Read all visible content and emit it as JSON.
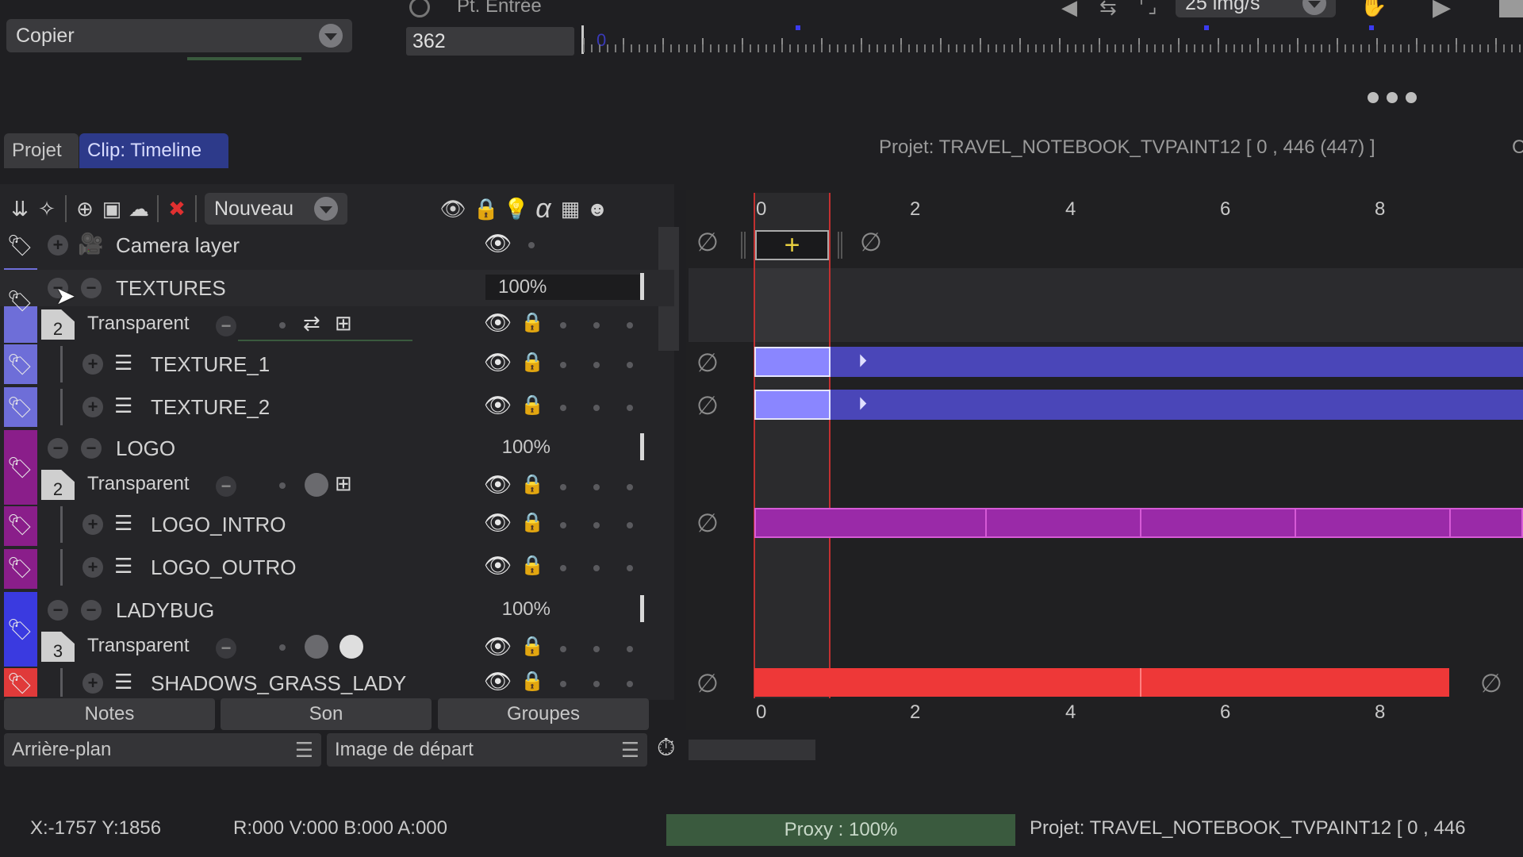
{
  "top": {
    "copy_dropdown": "Copier",
    "entry_label": "Pt. Entrée",
    "entry_value": "362",
    "ruler_start": "0",
    "fps_value": "25 img/s"
  },
  "tabs": {
    "projet": "Projet",
    "clip": "Clip: Timeline"
  },
  "project_title": "Projet: TRAVEL_NOTEBOOK_TVPAINT12 [ 0 , 446  (447) ]",
  "project_title_cut": "C",
  "layer_toolbar": {
    "new_dropdown": "Nouveau",
    "alpha": "α"
  },
  "layers": {
    "camera": {
      "name": "Camera layer"
    },
    "textures": {
      "name": "TEXTURES",
      "opacity": "100%",
      "mode": "Transparent",
      "count": "2",
      "color": "#6e6ed8"
    },
    "texture_1": {
      "name": "TEXTURE_1",
      "color": "#6e6ed8"
    },
    "texture_2": {
      "name": "TEXTURE_2",
      "color": "#6e6ed8"
    },
    "logo": {
      "name": "LOGO",
      "opacity": "100%",
      "mode": "Transparent",
      "count": "2",
      "color": "#8a1e8a"
    },
    "logo_intro": {
      "name": "LOGO_INTRO",
      "color": "#8a1e8a"
    },
    "logo_outro": {
      "name": "LOGO_OUTRO",
      "color": "#8a1e8a"
    },
    "ladybug": {
      "name": "LADYBUG",
      "opacity": "100%",
      "mode": "Transparent",
      "count": "3",
      "color": "#3a3ae0"
    },
    "shadows": {
      "name": "SHADOWS_GRASS_LADY",
      "color": "#e03a3a"
    }
  },
  "timeline": {
    "ticks_top": [
      "0",
      "2",
      "4",
      "6",
      "8"
    ],
    "ticks_bottom": [
      "0",
      "2",
      "4",
      "6",
      "8"
    ],
    "colors": {
      "texture_track": "#4a46b8",
      "texture_key": "#8a86ff",
      "logo_track": "#9a2aa8",
      "shadow_track": "#ee3838"
    }
  },
  "bottom": {
    "tab_notes": "Notes",
    "tab_son": "Son",
    "tab_groupes": "Groupes",
    "background_dropdown": "Arrière-plan",
    "start_image_dropdown": "Image de départ"
  },
  "status": {
    "coords": "X:-1757  Y:1856",
    "color": "R:000 V:000 B:000 A:000",
    "proxy": "Proxy : 100%",
    "project": "Projet: TRAVEL_NOTEBOOK_TVPAINT12 [ 0 , 446"
  }
}
